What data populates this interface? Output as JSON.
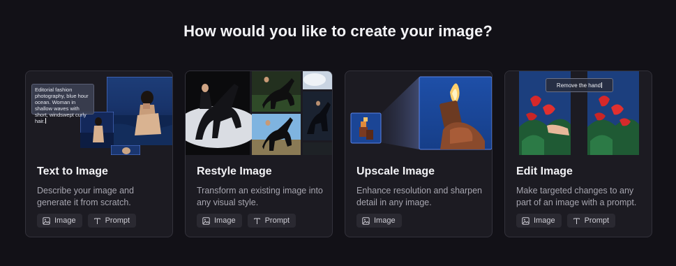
{
  "page": {
    "title": "How would you like to create your image?"
  },
  "cards": [
    {
      "title": "Text to Image",
      "description": "Describe your image and generate it from scratch.",
      "overlay_text": "Editorial fashion photography, blue hour ocean. Woman in shallow waves with short, windswept curly hair.",
      "chips": [
        {
          "label": "Image",
          "icon": "image-icon"
        },
        {
          "label": "Prompt",
          "icon": "text-icon"
        }
      ]
    },
    {
      "title": "Restyle Image",
      "description": "Transform an existing image into any visual style.",
      "chips": [
        {
          "label": "Image",
          "icon": "image-icon"
        },
        {
          "label": "Prompt",
          "icon": "text-icon"
        }
      ]
    },
    {
      "title": "Upscale Image",
      "description": "Enhance resolution and sharpen detail in any image.",
      "chips": [
        {
          "label": "Image",
          "icon": "image-icon"
        }
      ]
    },
    {
      "title": "Edit Image",
      "description": "Make targeted changes to any part of an image with a prompt.",
      "overlay_text": "Remove the hand",
      "chips": [
        {
          "label": "Image",
          "icon": "image-icon"
        },
        {
          "label": "Prompt",
          "icon": "text-icon"
        }
      ]
    }
  ],
  "colors": {
    "background": "#121117",
    "card": "#1c1b22",
    "card_border": "#33323b",
    "chip": "#2a2931",
    "accent_frame": "#5b83e6"
  }
}
